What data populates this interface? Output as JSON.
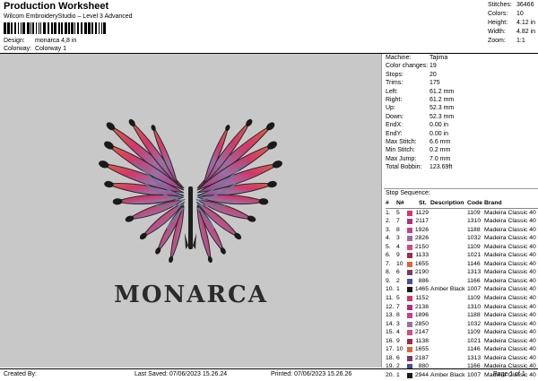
{
  "header": {
    "title": "Production Worksheet",
    "subtitle": "Wilcom EmbroideryStudio – Level 3 Advanced",
    "design_label": "Design:",
    "design_value": "monarca 4,8 in",
    "colorway_label": "Colorway:",
    "colorway_value": "Colorway 1"
  },
  "stats": [
    {
      "label": "Stitches:",
      "value": "36466"
    },
    {
      "label": "Colors:",
      "value": "10"
    },
    {
      "label": "Height:",
      "value": "4.12 in"
    },
    {
      "label": "Width:",
      "value": "4.82 in"
    },
    {
      "label": "Zoom:",
      "value": "1:1"
    }
  ],
  "design_text": "MONARCA",
  "info": [
    {
      "label": "Machine:",
      "value": "Tajima"
    },
    {
      "label": "Color changes:",
      "value": "19"
    },
    {
      "label": "Stops:",
      "value": "20"
    },
    {
      "label": "Trims:",
      "value": "175"
    },
    {
      "label": "Left:",
      "value": "61.2 mm"
    },
    {
      "label": "Right:",
      "value": "61.2 mm"
    },
    {
      "label": "Up:",
      "value": "52.3 mm"
    },
    {
      "label": "Down:",
      "value": "52.3 mm"
    },
    {
      "label": "EndX:",
      "value": "0.00 in"
    },
    {
      "label": "EndY:",
      "value": "0.00 in"
    },
    {
      "label": "Max Stitch:",
      "value": "6.6 mm"
    },
    {
      "label": "Min Stitch:",
      "value": "0.2 mm"
    },
    {
      "label": "Max Jump:",
      "value": "7.0 mm"
    },
    {
      "label": "Total Bobbin:",
      "value": "123.69ft"
    }
  ],
  "sequence_title": "Stop Sequence:",
  "seq_headers": {
    "num": "#",
    "n": "N#",
    "st": "St.",
    "desc": "Description",
    "code": "Code",
    "brand": "Brand"
  },
  "sequence": [
    {
      "num": "1.",
      "n": "5",
      "color": "#d2386c",
      "st": "1129",
      "desc": "",
      "code": "1109",
      "brand": "Madeira Classic 40"
    },
    {
      "num": "2.",
      "n": "7",
      "color": "#b0307a",
      "st": "2117",
      "desc": "",
      "code": "1310",
      "brand": "Madeira Classic 40"
    },
    {
      "num": "3.",
      "n": "8",
      "color": "#c4428e",
      "st": "1926",
      "desc": "",
      "code": "1188",
      "brand": "Madeira Classic 40"
    },
    {
      "num": "4.",
      "n": "3",
      "color": "#9a6fa3",
      "st": "2826",
      "desc": "",
      "code": "1032",
      "brand": "Madeira Classic 40"
    },
    {
      "num": "5.",
      "n": "4",
      "color": "#d44b7c",
      "st": "2150",
      "desc": "",
      "code": "1109",
      "brand": "Madeira Classic 40"
    },
    {
      "num": "6.",
      "n": "9",
      "color": "#a22a47",
      "st": "1133",
      "desc": "",
      "code": "1021",
      "brand": "Madeira Classic 40"
    },
    {
      "num": "7.",
      "n": "10",
      "color": "#e0643a",
      "st": "1655",
      "desc": "",
      "code": "1146",
      "brand": "Madeira Classic 40"
    },
    {
      "num": "8.",
      "n": "6",
      "color": "#7b3a66",
      "st": "2190",
      "desc": "",
      "code": "1313",
      "brand": "Madeira Classic 40"
    },
    {
      "num": "9.",
      "n": "2",
      "color": "#4a4f8e",
      "st": "886",
      "desc": "",
      "code": "1166",
      "brand": "Madeira Classic 40"
    },
    {
      "num": "10.",
      "n": "1",
      "color": "#1a1a1a",
      "st": "1465",
      "desc": "Amber Black",
      "code": "1007",
      "brand": "Madeira Classic 40"
    },
    {
      "num": "11.",
      "n": "5",
      "color": "#d2386c",
      "st": "1152",
      "desc": "",
      "code": "1109",
      "brand": "Madeira Classic 40"
    },
    {
      "num": "12.",
      "n": "7",
      "color": "#b0307a",
      "st": "2138",
      "desc": "",
      "code": "1310",
      "brand": "Madeira Classic 40"
    },
    {
      "num": "13.",
      "n": "8",
      "color": "#c4428e",
      "st": "1896",
      "desc": "",
      "code": "1188",
      "brand": "Madeira Classic 40"
    },
    {
      "num": "14.",
      "n": "3",
      "color": "#9a6fa3",
      "st": "2850",
      "desc": "",
      "code": "1032",
      "brand": "Madeira Classic 40"
    },
    {
      "num": "15.",
      "n": "4",
      "color": "#d44b7c",
      "st": "2147",
      "desc": "",
      "code": "1109",
      "brand": "Madeira Classic 40"
    },
    {
      "num": "16.",
      "n": "9",
      "color": "#a22a47",
      "st": "1138",
      "desc": "",
      "code": "1021",
      "brand": "Madeira Classic 40"
    },
    {
      "num": "17.",
      "n": "10",
      "color": "#e0643a",
      "st": "1655",
      "desc": "",
      "code": "1146",
      "brand": "Madeira Classic 40"
    },
    {
      "num": "18.",
      "n": "6",
      "color": "#7b3a66",
      "st": "2187",
      "desc": "",
      "code": "1313",
      "brand": "Madeira Classic 40"
    },
    {
      "num": "19.",
      "n": "2",
      "color": "#4a4f8e",
      "st": "880",
      "desc": "",
      "code": "1166",
      "brand": "Madeira Classic 40"
    },
    {
      "num": "20.",
      "n": "1",
      "color": "#1a1a1a",
      "st": "2944",
      "desc": "Amber Black",
      "code": "1007",
      "brand": "Madeira Classic 40"
    }
  ],
  "footer": {
    "created": "Created By:",
    "saved": "Last Saved: 07/06/2023 15.26.24",
    "printed": "Printed: 07/06/2023 15.26.26",
    "page": "Page 1 of 1"
  }
}
